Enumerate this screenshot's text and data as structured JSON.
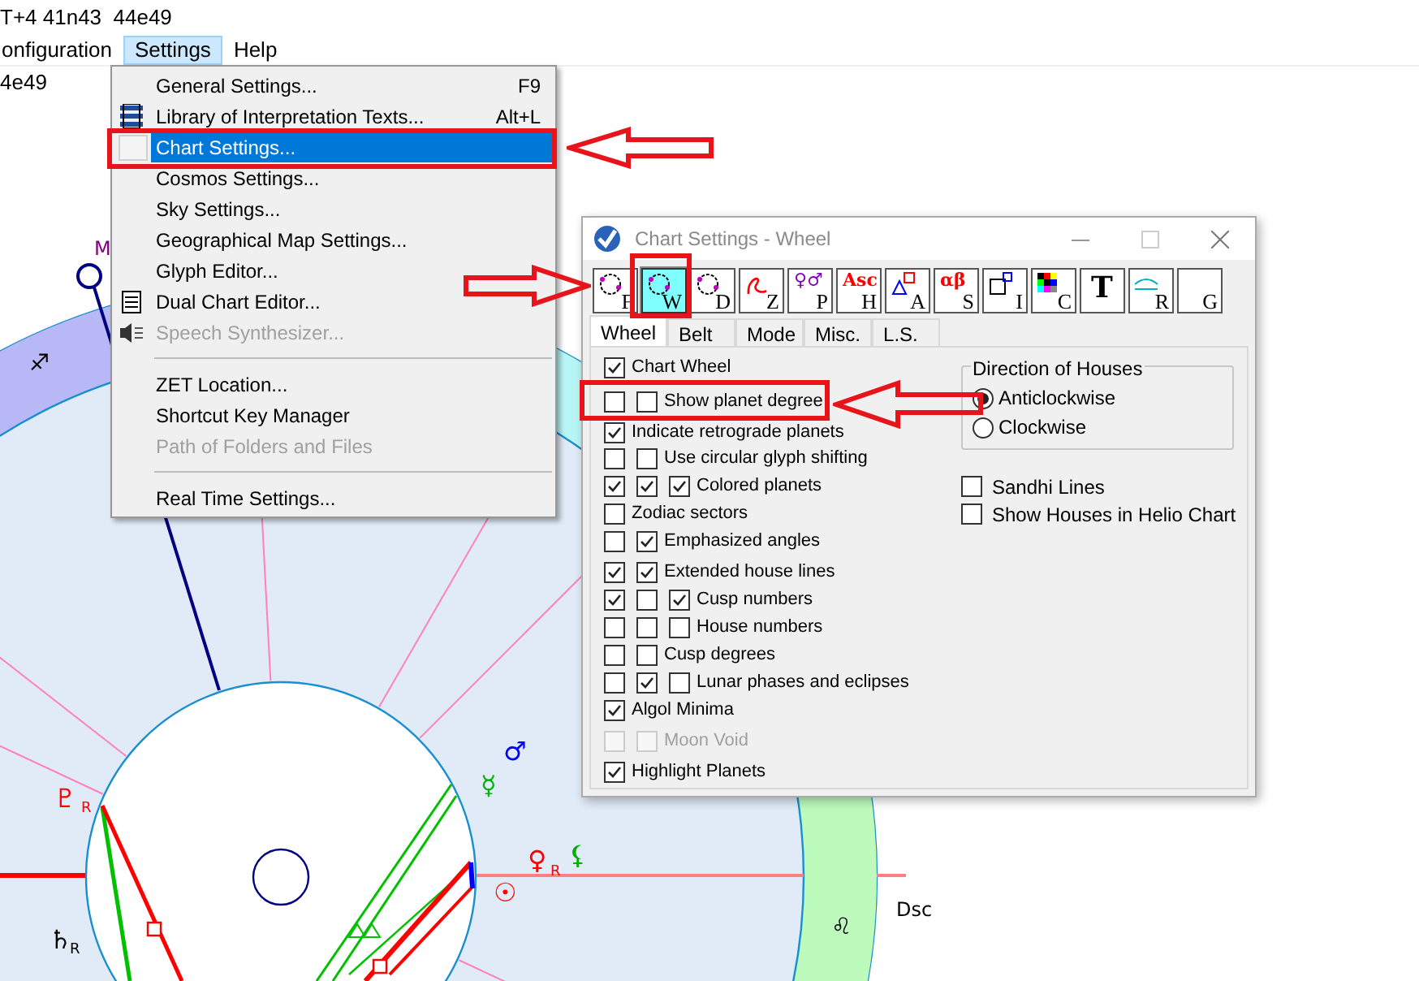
{
  "header": {
    "coordinates": "T+4 41n43  44e49",
    "sub_coordinates": "4e49"
  },
  "menubar": [
    {
      "label": "onfiguration",
      "selected": false
    },
    {
      "label": "Settings",
      "selected": true
    },
    {
      "label": "Help",
      "selected": false
    }
  ],
  "settings_menu": [
    {
      "kind": "item",
      "label": "General Settings...",
      "shortcut": "F9",
      "disabled": false,
      "selected": false
    },
    {
      "kind": "item",
      "label": "Library of Interpretation Texts...",
      "shortcut": "Alt+L",
      "disabled": false,
      "selected": false
    },
    {
      "kind": "item",
      "label": "Chart Settings...",
      "disabled": false,
      "selected": true
    },
    {
      "kind": "item",
      "label": "Cosmos Settings...",
      "disabled": false,
      "selected": false
    },
    {
      "kind": "item",
      "label": "Sky Settings...",
      "disabled": false,
      "selected": false
    },
    {
      "kind": "item",
      "label": "Geographical Map Settings...",
      "disabled": false,
      "selected": false
    },
    {
      "kind": "item",
      "label": "Glyph Editor...",
      "disabled": false,
      "selected": false
    },
    {
      "kind": "item",
      "label": "Dual Chart Editor...",
      "disabled": false,
      "selected": false
    },
    {
      "kind": "item",
      "label": "Speech Synthesizer...",
      "disabled": true,
      "selected": false
    },
    {
      "kind": "separator"
    },
    {
      "kind": "item",
      "label": "ZET Location...",
      "disabled": false,
      "selected": false
    },
    {
      "kind": "item",
      "label": "Shortcut Key Manager",
      "disabled": false,
      "selected": false
    },
    {
      "kind": "item",
      "label": "Path of Folders and Files",
      "disabled": true,
      "selected": false
    },
    {
      "kind": "separator"
    },
    {
      "kind": "item",
      "label": "Real Time Settings...",
      "disabled": false,
      "selected": false
    }
  ],
  "chart_labels": [
    {
      "text": "M",
      "color": "#800080"
    },
    {
      "text": "♐",
      "color": "#000000"
    },
    {
      "text": "♇",
      "color": "#ff0000"
    },
    {
      "text": "R",
      "color": "#ff0000"
    },
    {
      "text": "♄",
      "color": "#000000"
    },
    {
      "text": "R",
      "color": "#000000"
    },
    {
      "text": "♂",
      "color": "#0000ff"
    },
    {
      "text": "☿",
      "color": "#00b000"
    },
    {
      "text": "♀",
      "color": "#ff0000"
    },
    {
      "text": "R",
      "color": "#ff0000"
    },
    {
      "text": "⚸",
      "color": "#00b000"
    },
    {
      "text": "☉",
      "color": "#ff0000"
    },
    {
      "text": "♌",
      "color": "#000000"
    },
    {
      "text": "Dsc",
      "color": "#000000"
    }
  ],
  "dialog": {
    "title": "Chart Settings - Wheel",
    "toolbar": [
      {
        "kind": "wheel",
        "letter": "F",
        "selected": false
      },
      {
        "kind": "wheel",
        "letter": "W",
        "selected": true
      },
      {
        "kind": "wheel",
        "letter": "D",
        "selected": false
      },
      {
        "kind": "zodiac",
        "letter": "Z",
        "selected": false
      },
      {
        "kind": "glyph",
        "glyph": "♀♂",
        "color": "#8000c0",
        "letter": "P",
        "selected": false
      },
      {
        "kind": "glyph",
        "glyph": "Asc",
        "color": "#ff0000",
        "letter": "H",
        "selected": false
      },
      {
        "kind": "aspects",
        "letter": "A",
        "selected": false
      },
      {
        "kind": "glyph",
        "glyph": "αβ",
        "color": "#ff0000",
        "letter": "S",
        "selected": false
      },
      {
        "kind": "squares",
        "letter": "I",
        "selected": false
      },
      {
        "kind": "colors",
        "letter": "C",
        "selected": false
      },
      {
        "kind": "glyph",
        "glyph": "T",
        "color": "#000000",
        "selected": false
      },
      {
        "kind": "rule",
        "letter": "R",
        "selected": false
      },
      {
        "kind": "blank",
        "letter": "G",
        "selected": false
      }
    ],
    "tabs": [
      {
        "label": "Wheel",
        "selected": true
      },
      {
        "label": "Belt",
        "selected": false
      },
      {
        "label": "Mode",
        "selected": false
      },
      {
        "label": "Misc.",
        "selected": false
      },
      {
        "label": "L.S.",
        "selected": false
      }
    ],
    "options": [
      {
        "label": "Chart Wheel",
        "boxes": [
          true
        ],
        "disabled": false
      },
      {
        "label": "Show planet degree",
        "boxes": [
          false,
          false
        ],
        "disabled": false
      },
      {
        "label": "Indicate retrograde planets",
        "boxes": [
          true
        ],
        "disabled": false
      },
      {
        "label": "Use circular glyph shifting",
        "boxes": [
          false,
          false
        ],
        "disabled": false
      },
      {
        "label": "Colored planets",
        "boxes": [
          true,
          true,
          true
        ],
        "disabled": false
      },
      {
        "label": "Zodiac sectors",
        "boxes": [
          false
        ],
        "disabled": false
      },
      {
        "label": "Emphasized angles",
        "boxes": [
          false,
          true
        ],
        "disabled": false
      },
      {
        "label": "Extended house lines",
        "boxes": [
          true,
          true
        ],
        "disabled": false
      },
      {
        "label": "Cusp numbers",
        "boxes": [
          true,
          false,
          true
        ],
        "disabled": false
      },
      {
        "label": "House numbers",
        "boxes": [
          false,
          false,
          false
        ],
        "disabled": false
      },
      {
        "label": "Cusp degrees",
        "boxes": [
          false,
          false
        ],
        "disabled": false
      },
      {
        "label": "Lunar phases and eclipses",
        "boxes": [
          false,
          true,
          false
        ],
        "disabled": false
      },
      {
        "label": "Algol Minima",
        "boxes": [
          true
        ],
        "disabled": false
      },
      {
        "label": "Moon Void",
        "boxes": [
          false,
          false
        ],
        "disabled": true
      },
      {
        "label": "Highlight Planets",
        "boxes": [
          true
        ],
        "disabled": false
      }
    ],
    "direction_group": {
      "title": "Direction of Houses",
      "options": [
        {
          "label": "Anticlockwise",
          "selected": true
        },
        {
          "label": "Clockwise",
          "selected": false
        }
      ]
    },
    "extra_options": [
      {
        "label": "Sandhi Lines",
        "checked": false
      },
      {
        "label": "Show Houses in Helio Chart",
        "checked": false
      }
    ]
  }
}
